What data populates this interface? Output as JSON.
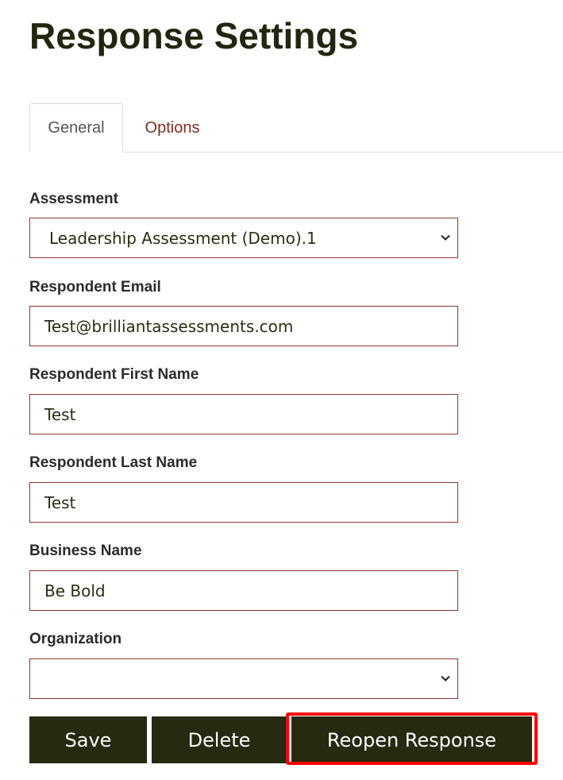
{
  "page": {
    "title": "Response Settings"
  },
  "tabs": [
    {
      "label": "General",
      "active": true
    },
    {
      "label": "Options",
      "active": false
    }
  ],
  "form": {
    "assessment": {
      "label": "Assessment",
      "value": "Leadership Assessment (Demo).1",
      "icon": "chevron-down-icon"
    },
    "email": {
      "label": "Respondent Email",
      "value": "Test@brilliantassessments.com"
    },
    "first_name": {
      "label": "Respondent First Name",
      "value": "Test"
    },
    "last_name": {
      "label": "Respondent Last Name",
      "value": "Test"
    },
    "business_name": {
      "label": "Business Name",
      "value": "Be Bold"
    },
    "organization": {
      "label": "Organization",
      "value": "",
      "icon": "chevron-down-icon"
    }
  },
  "buttons": {
    "save": "Save",
    "delete": "Delete",
    "reopen": "Reopen Response"
  },
  "colors": {
    "primary_dark": "#272a10",
    "field_border": "#8b3a32",
    "options_tab_text": "#7a2e22",
    "highlight": "#ff0000"
  }
}
